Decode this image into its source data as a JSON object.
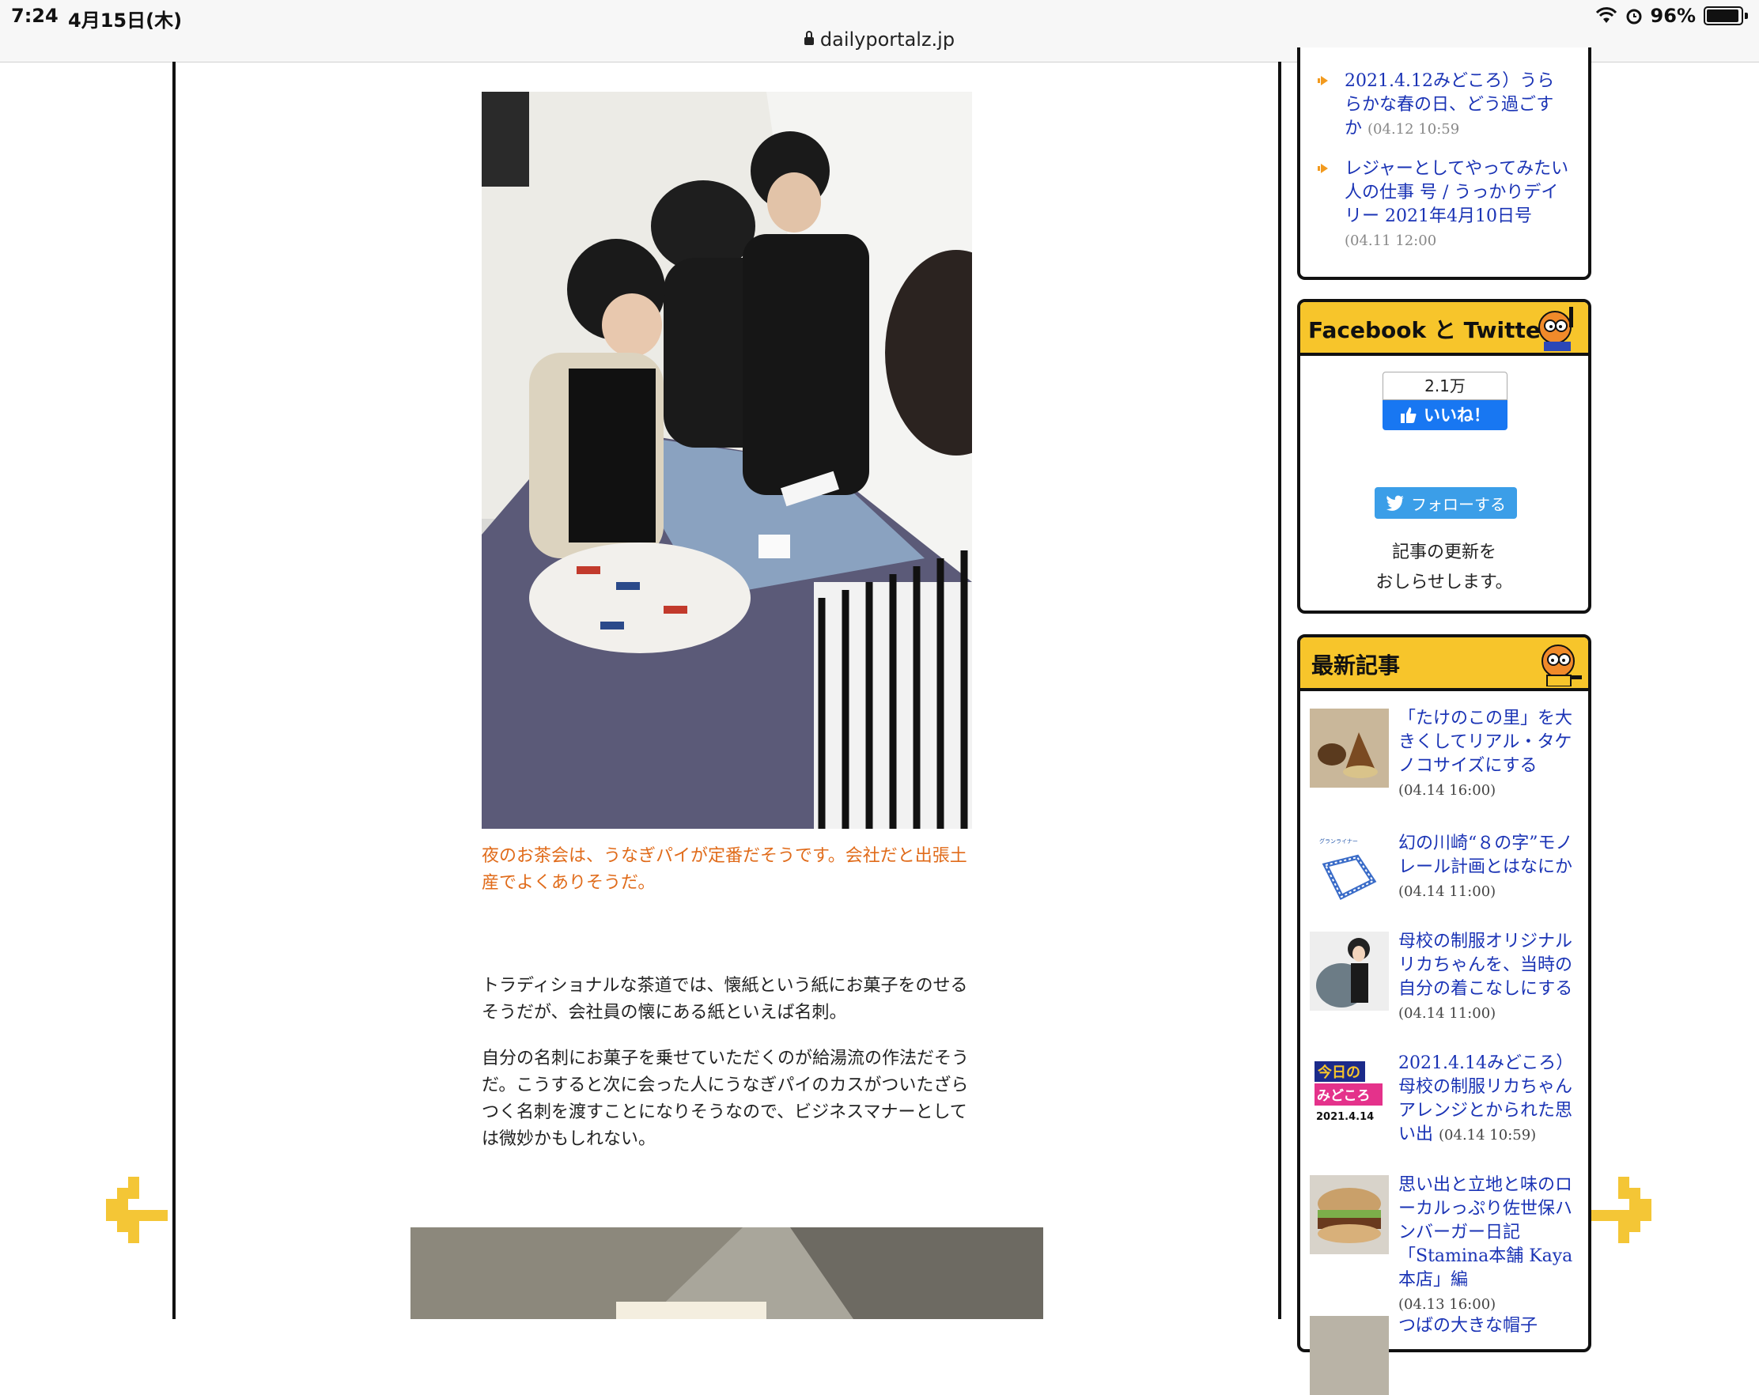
{
  "status_bar": {
    "time": "7:24",
    "date": "4月15日(木)",
    "battery": "96%"
  },
  "address_bar": {
    "url": "dailyportalz.jp"
  },
  "article": {
    "photo1_alt": "給湯室でお茶会をする4人",
    "caption": "夜のお茶会は、うなぎパイが定番だそうです。会社だと出張土産でよくありそうだ。",
    "paragraphs": [
      "トラディショナルな茶道では、懐紙という紙にお菓子をのせるそうだが、会社員の懐にある紙といえば名刺。",
      "自分の名刺にお菓子を乗せていただくのが給湯流の作法だそうだ。こうすると次に会った人にうなぎパイのカスがついたざらつく名刺を渡すことになりそうなので、ビジネスマナーとしては微妙かもしれない。"
    ]
  },
  "sidebar": {
    "recent_list": [
      {
        "title": "2021.4.12みどころ）うららかな春の日、どう過ごすか",
        "time": "(04.12 10:59"
      },
      {
        "title": "レジャーとしてやってみたい人の仕事 号 / うっかりデイリー 2021年4月10日号",
        "time": "(04.11 12:00"
      }
    ],
    "social": {
      "heading": "Facebook と Twitter",
      "like_count": "2.1万",
      "like_label": "いいね！",
      "follow_label": "フォローする",
      "notice_line1": "記事の更新を",
      "notice_line2": "おしらせします。"
    },
    "latest": {
      "heading": "最新記事",
      "items": [
        {
          "title": "「たけのこの里」を大きくしてリアル・タケノコサイズにする",
          "time": "(04.14 16:00)"
        },
        {
          "title": "幻の川崎“８の字”モノレール計画とはなにか",
          "time": "(04.14 11:00)"
        },
        {
          "title": "母校の制服オリジナルリカちゃんを、当時の自分の着こなしにする",
          "time": "(04.14 11:00)"
        },
        {
          "title": "2021.4.14みどころ）母校の制服リカちゃんアレンジとかられた思い出",
          "time": "(04.14 10:59)"
        },
        {
          "title": "思い出と立地と味のローカルっぷり佐世保ハンバーガー日記「Stamina本舗 Kaya本店」編",
          "time": "(04.13 16:00)"
        },
        {
          "title": "つばの大きな帽子",
          "time": ""
        }
      ],
      "thumb_text": {
        "top": "今日の",
        "mid": "みどころ",
        "date": "2021.4.14",
        "map": "グランライナー"
      }
    },
    "colors": {
      "link": "#1a33b5",
      "accent": "#f7c52b",
      "caption": "#e06b1a"
    }
  }
}
